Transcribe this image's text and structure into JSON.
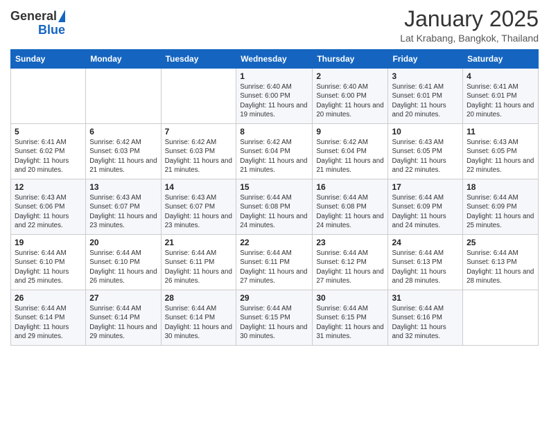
{
  "header": {
    "logo_line1": "General",
    "logo_line2": "Blue",
    "month": "January 2025",
    "location": "Lat Krabang, Bangkok, Thailand"
  },
  "weekdays": [
    "Sunday",
    "Monday",
    "Tuesday",
    "Wednesday",
    "Thursday",
    "Friday",
    "Saturday"
  ],
  "weeks": [
    [
      {
        "day": "",
        "info": ""
      },
      {
        "day": "",
        "info": ""
      },
      {
        "day": "",
        "info": ""
      },
      {
        "day": "1",
        "info": "Sunrise: 6:40 AM\nSunset: 6:00 PM\nDaylight: 11 hours and 19 minutes."
      },
      {
        "day": "2",
        "info": "Sunrise: 6:40 AM\nSunset: 6:00 PM\nDaylight: 11 hours and 20 minutes."
      },
      {
        "day": "3",
        "info": "Sunrise: 6:41 AM\nSunset: 6:01 PM\nDaylight: 11 hours and 20 minutes."
      },
      {
        "day": "4",
        "info": "Sunrise: 6:41 AM\nSunset: 6:01 PM\nDaylight: 11 hours and 20 minutes."
      }
    ],
    [
      {
        "day": "5",
        "info": "Sunrise: 6:41 AM\nSunset: 6:02 PM\nDaylight: 11 hours and 20 minutes."
      },
      {
        "day": "6",
        "info": "Sunrise: 6:42 AM\nSunset: 6:03 PM\nDaylight: 11 hours and 21 minutes."
      },
      {
        "day": "7",
        "info": "Sunrise: 6:42 AM\nSunset: 6:03 PM\nDaylight: 11 hours and 21 minutes."
      },
      {
        "day": "8",
        "info": "Sunrise: 6:42 AM\nSunset: 6:04 PM\nDaylight: 11 hours and 21 minutes."
      },
      {
        "day": "9",
        "info": "Sunrise: 6:42 AM\nSunset: 6:04 PM\nDaylight: 11 hours and 21 minutes."
      },
      {
        "day": "10",
        "info": "Sunrise: 6:43 AM\nSunset: 6:05 PM\nDaylight: 11 hours and 22 minutes."
      },
      {
        "day": "11",
        "info": "Sunrise: 6:43 AM\nSunset: 6:05 PM\nDaylight: 11 hours and 22 minutes."
      }
    ],
    [
      {
        "day": "12",
        "info": "Sunrise: 6:43 AM\nSunset: 6:06 PM\nDaylight: 11 hours and 22 minutes."
      },
      {
        "day": "13",
        "info": "Sunrise: 6:43 AM\nSunset: 6:07 PM\nDaylight: 11 hours and 23 minutes."
      },
      {
        "day": "14",
        "info": "Sunrise: 6:43 AM\nSunset: 6:07 PM\nDaylight: 11 hours and 23 minutes."
      },
      {
        "day": "15",
        "info": "Sunrise: 6:44 AM\nSunset: 6:08 PM\nDaylight: 11 hours and 24 minutes."
      },
      {
        "day": "16",
        "info": "Sunrise: 6:44 AM\nSunset: 6:08 PM\nDaylight: 11 hours and 24 minutes."
      },
      {
        "day": "17",
        "info": "Sunrise: 6:44 AM\nSunset: 6:09 PM\nDaylight: 11 hours and 24 minutes."
      },
      {
        "day": "18",
        "info": "Sunrise: 6:44 AM\nSunset: 6:09 PM\nDaylight: 11 hours and 25 minutes."
      }
    ],
    [
      {
        "day": "19",
        "info": "Sunrise: 6:44 AM\nSunset: 6:10 PM\nDaylight: 11 hours and 25 minutes."
      },
      {
        "day": "20",
        "info": "Sunrise: 6:44 AM\nSunset: 6:10 PM\nDaylight: 11 hours and 26 minutes."
      },
      {
        "day": "21",
        "info": "Sunrise: 6:44 AM\nSunset: 6:11 PM\nDaylight: 11 hours and 26 minutes."
      },
      {
        "day": "22",
        "info": "Sunrise: 6:44 AM\nSunset: 6:11 PM\nDaylight: 11 hours and 27 minutes."
      },
      {
        "day": "23",
        "info": "Sunrise: 6:44 AM\nSunset: 6:12 PM\nDaylight: 11 hours and 27 minutes."
      },
      {
        "day": "24",
        "info": "Sunrise: 6:44 AM\nSunset: 6:13 PM\nDaylight: 11 hours and 28 minutes."
      },
      {
        "day": "25",
        "info": "Sunrise: 6:44 AM\nSunset: 6:13 PM\nDaylight: 11 hours and 28 minutes."
      }
    ],
    [
      {
        "day": "26",
        "info": "Sunrise: 6:44 AM\nSunset: 6:14 PM\nDaylight: 11 hours and 29 minutes."
      },
      {
        "day": "27",
        "info": "Sunrise: 6:44 AM\nSunset: 6:14 PM\nDaylight: 11 hours and 29 minutes."
      },
      {
        "day": "28",
        "info": "Sunrise: 6:44 AM\nSunset: 6:14 PM\nDaylight: 11 hours and 30 minutes."
      },
      {
        "day": "29",
        "info": "Sunrise: 6:44 AM\nSunset: 6:15 PM\nDaylight: 11 hours and 30 minutes."
      },
      {
        "day": "30",
        "info": "Sunrise: 6:44 AM\nSunset: 6:15 PM\nDaylight: 11 hours and 31 minutes."
      },
      {
        "day": "31",
        "info": "Sunrise: 6:44 AM\nSunset: 6:16 PM\nDaylight: 11 hours and 32 minutes."
      },
      {
        "day": "",
        "info": ""
      }
    ]
  ]
}
